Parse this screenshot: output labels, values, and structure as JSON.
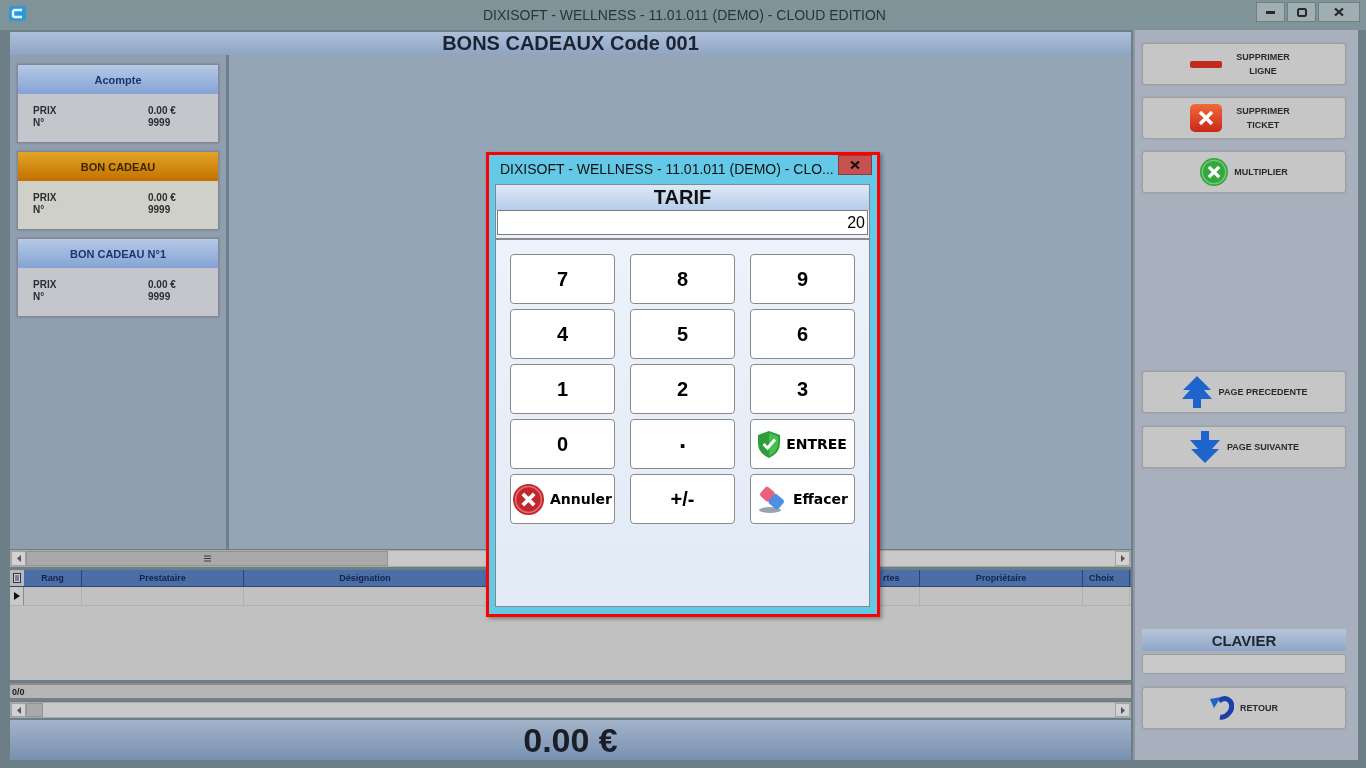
{
  "window": {
    "title": "DIXISOFT - WELLNESS - 11.01.011 (DEMO) - CLOUD EDITION"
  },
  "header": {
    "title": "BONS CADEAUX Code 001"
  },
  "cards": [
    {
      "title": "Acompte",
      "selected": false,
      "fields": [
        {
          "label": "PRIX",
          "value": "0.00 €"
        },
        {
          "label": "N°",
          "value": "9999"
        }
      ]
    },
    {
      "title": "BON CADEAU",
      "selected": true,
      "fields": [
        {
          "label": "PRIX",
          "value": "0.00 €"
        },
        {
          "label": "N°",
          "value": "9999"
        }
      ]
    },
    {
      "title": "BON CADEAU N°1",
      "selected": false,
      "fields": [
        {
          "label": "PRIX",
          "value": "0.00 €"
        },
        {
          "label": "N°",
          "value": "9999"
        }
      ]
    }
  ],
  "table": {
    "columns": [
      "Rang",
      "Prestataire",
      "Désignation",
      "rtes",
      "Propriétaire",
      "Choix"
    ]
  },
  "pager": "0/0",
  "total": "0.00 €",
  "actions": [
    {
      "label": "SUPPRIMER LIGNE",
      "kind": "remove-line"
    },
    {
      "label": "SUPPRIMER TICKET",
      "kind": "remove-ticket"
    },
    {
      "label": "MULTIPLIER",
      "kind": "multiply"
    }
  ],
  "navigation": [
    {
      "label": "PAGE PRECEDENTE",
      "kind": "previous"
    },
    {
      "label": "PAGE SUIVANTE",
      "kind": "next"
    }
  ],
  "keyboard": {
    "title": "CLAVIER"
  },
  "back_button": {
    "label": "RETOUR"
  },
  "dialog": {
    "title": "DIXISOFT - WELLNESS - 11.01.011 (DEMO) - CLO...",
    "heading": "TARIF",
    "value": "20",
    "keys": [
      {
        "label": "7",
        "kind": "digit"
      },
      {
        "label": "8",
        "kind": "digit"
      },
      {
        "label": "9",
        "kind": "digit"
      },
      {
        "label": "4",
        "kind": "digit"
      },
      {
        "label": "5",
        "kind": "digit"
      },
      {
        "label": "6",
        "kind": "digit"
      },
      {
        "label": "1",
        "kind": "digit"
      },
      {
        "label": "2",
        "kind": "digit"
      },
      {
        "label": "3",
        "kind": "digit"
      },
      {
        "label": "0",
        "kind": "digit"
      },
      {
        "label": ".",
        "kind": "decimal"
      },
      {
        "label": "ENTREE",
        "kind": "enter"
      },
      {
        "label": "Annuler",
        "kind": "cancel"
      },
      {
        "label": "+/-",
        "kind": "sign"
      },
      {
        "label": "Effacer",
        "kind": "clear"
      }
    ]
  }
}
